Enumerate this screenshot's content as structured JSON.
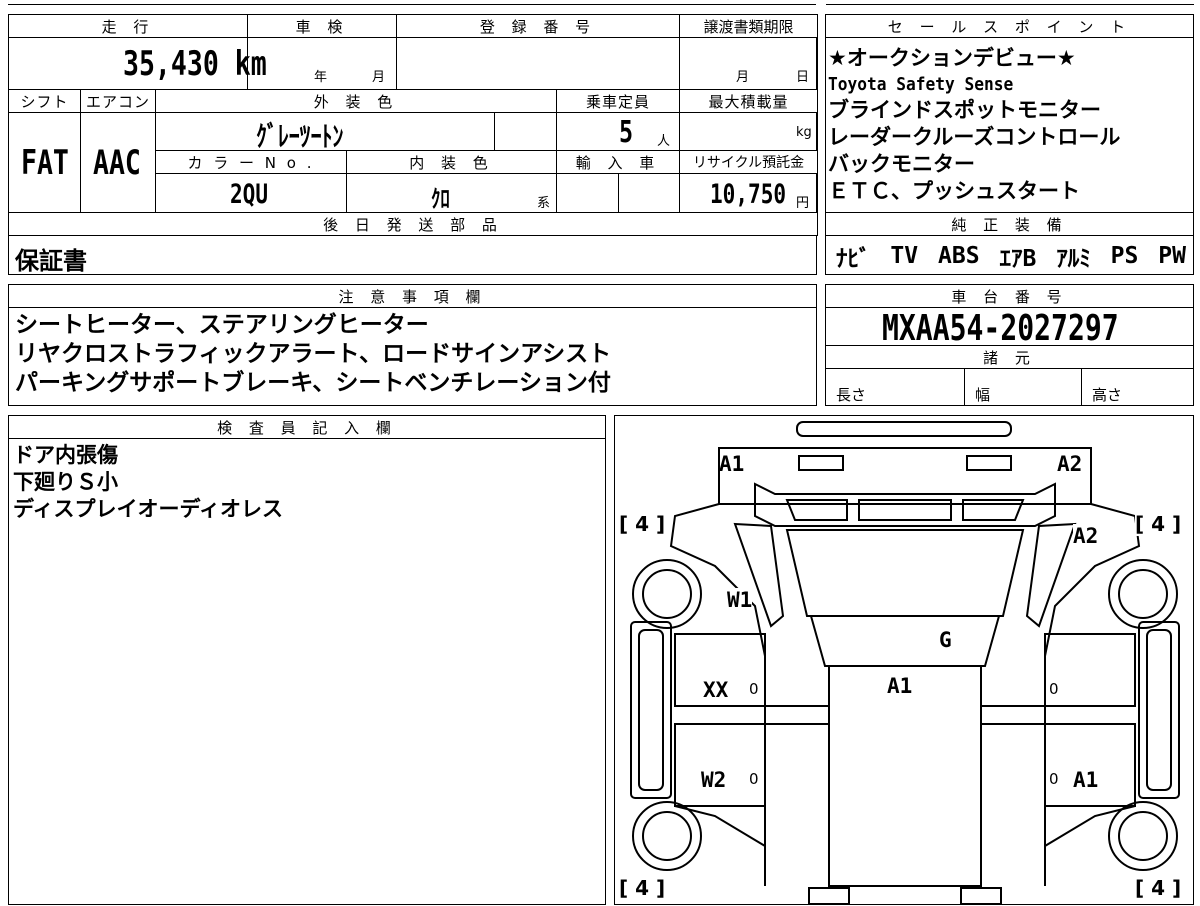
{
  "vehicle": {
    "headers": {
      "mileage": "走 行",
      "inspection": "車 検",
      "registration": "登 録 番 号",
      "transfer_deadline": "譲渡書類期限",
      "shift": "シフト",
      "aircon": "エアコン",
      "exterior_color": "外 装 色",
      "capacity": "乗車定員",
      "max_load": "最大積載量",
      "color_no": "カ ラ ー N o .",
      "interior_color": "内 装 色",
      "import": "輸 入 車",
      "recycle": "リサイクル預託金",
      "later_parts": "後 日 発 送 部 品"
    },
    "mileage": "35,430 km",
    "inspection_year_unit": "年",
    "inspection_month_unit": "月",
    "transfer_month_unit": "月",
    "transfer_day_unit": "日",
    "shift": "FAT",
    "aircon": "AAC",
    "exterior_color": "ｸﾞﾚｰﾂｰﾄﾝ",
    "capacity": "5",
    "capacity_unit": "人",
    "max_load_unit": "kg",
    "color_no": "2QU",
    "interior_color": "ｸﾛ",
    "interior_suffix": "系",
    "recycle_fee": "10,750",
    "recycle_unit": "円",
    "later_parts": "保証書"
  },
  "sales_points": {
    "header": "セ ー ル ス ポ イ ン ト",
    "lines": [
      "★オークションデビュー★",
      "Toyota Safety Sense",
      "ブラインドスポットモニター",
      "レーダークルーズコントロール",
      "バックモニター",
      "ＥＴＣ、プッシュスタート"
    ]
  },
  "genuine_equipment": {
    "header": "純 正 装 備",
    "items": [
      "ﾅﾋﾞ",
      "TV",
      "ABS",
      "ｴｱB",
      "ｱﾙﾐ",
      "PS",
      "PW"
    ]
  },
  "notes": {
    "header": "注 意 事 項 欄",
    "lines": [
      "シートヒーター、ステアリングヒーター",
      "リヤクロストラフィックアラート、ロードサインアシスト",
      "パーキングサポートブレーキ、シートベンチレーション付"
    ]
  },
  "chassis": {
    "header": "車 台 番 号",
    "number": "MXAA54-2027297",
    "spec_header": "諸 元",
    "length_label": "長さ",
    "width_label": "幅",
    "height_label": "高さ"
  },
  "inspector": {
    "header": "検 査 員 記 入 欄",
    "lines": [
      "ドア内張傷",
      "下廻りＳ小",
      "ディスプレイオーディオレス"
    ]
  },
  "diagram": {
    "marks": {
      "front_left_bumper": "A1",
      "front_right_bumper": "A2",
      "right_front_fender": "A2",
      "left_front_fender": "W1",
      "windshield": "G",
      "roof": "A1",
      "left_front_door": "XX",
      "left_rear_door": "W2",
      "right_rear_door": "A1"
    },
    "tire_labels": [
      "[ 4 ]",
      "[ 4 ]",
      "[ 4 ]",
      "[ 4 ]"
    ],
    "zero": "0"
  }
}
